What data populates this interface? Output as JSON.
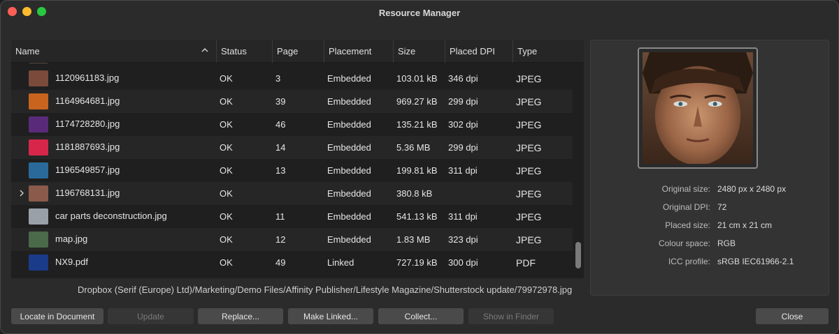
{
  "window": {
    "title": "Resource Manager"
  },
  "columns": {
    "name": "Name",
    "status": "Status",
    "page": "Page",
    "placement": "Placement",
    "size": "Size",
    "dpi": "Placed DPI",
    "type": "Type"
  },
  "rows": [
    {
      "name": "1120961183.jpg",
      "status": "OK",
      "page": "3",
      "placement": "Embedded",
      "size": "103.01 kB",
      "dpi": "346 dpi",
      "type": "JPEG",
      "thumb_color": "#7a4a3a"
    },
    {
      "name": "1164964681.jpg",
      "status": "OK",
      "page": "39",
      "placement": "Embedded",
      "size": "969.27 kB",
      "dpi": "299 dpi",
      "type": "JPEG",
      "thumb_color": "#c8641e"
    },
    {
      "name": "1174728280.jpg",
      "status": "OK",
      "page": "46",
      "placement": "Embedded",
      "size": "135.21 kB",
      "dpi": "302 dpi",
      "type": "JPEG",
      "thumb_color": "#5a2a7a"
    },
    {
      "name": "1181887693.jpg",
      "status": "OK",
      "page": "14",
      "placement": "Embedded",
      "size": "5.36 MB",
      "dpi": "299 dpi",
      "type": "JPEG",
      "thumb_color": "#d8264a"
    },
    {
      "name": "1196549857.jpg",
      "status": "OK",
      "page": "13",
      "placement": "Embedded",
      "size": "199.81 kB",
      "dpi": "311 dpi",
      "type": "JPEG",
      "thumb_color": "#2a6a9a"
    },
    {
      "name": "1196768131.jpg",
      "status": "OK",
      "page": "",
      "placement": "Embedded",
      "size": "380.8 kB",
      "dpi": "",
      "type": "JPEG",
      "thumb_color": "#8a5a4a"
    },
    {
      "name": "car parts deconstruction.jpg",
      "status": "OK",
      "page": "11",
      "placement": "Embedded",
      "size": "541.13 kB",
      "dpi": "311 dpi",
      "type": "JPEG",
      "thumb_color": "#9aa0a8"
    },
    {
      "name": "map.jpg",
      "status": "OK",
      "page": "12",
      "placement": "Embedded",
      "size": "1.83 MB",
      "dpi": "323 dpi",
      "type": "JPEG",
      "thumb_color": "#4a6a4a"
    },
    {
      "name": "NX9.pdf",
      "status": "OK",
      "page": "49",
      "placement": "Linked",
      "size": "727.19 kB",
      "dpi": "300 dpi",
      "type": "PDF",
      "thumb_color": "#1a3a8a"
    }
  ],
  "path": "Dropbox (Serif (Europe) Ltd)/Marketing/Demo Files/Affinity Publisher/Lifestyle Magazine/Shutterstock update/79972978.jpg",
  "info": {
    "original_size_label": "Original size:",
    "original_size": "2480 px x 2480 px",
    "original_dpi_label": "Original DPI:",
    "original_dpi": "72",
    "placed_size_label": "Placed size:",
    "placed_size": "21 cm x 21 cm",
    "colour_space_label": "Colour space:",
    "colour_space": "RGB",
    "icc_label": "ICC profile:",
    "icc": "sRGB IEC61966-2.1"
  },
  "buttons": {
    "locate": "Locate in Document",
    "update": "Update",
    "replace": "Replace...",
    "make_linked": "Make Linked...",
    "collect": "Collect...",
    "show_finder": "Show in Finder",
    "close": "Close"
  }
}
